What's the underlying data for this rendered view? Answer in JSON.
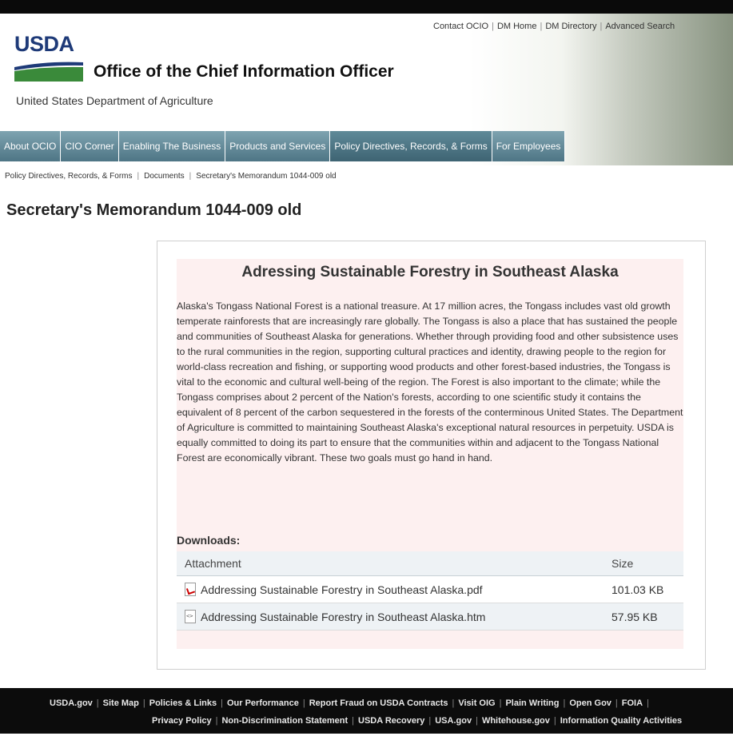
{
  "top_links": [
    "Contact OCIO",
    "DM Home",
    "DM Directory",
    "Advanced Search"
  ],
  "logo_text": "USDA",
  "site_title": "Office of the Chief Information Officer",
  "site_subtitle": "United States Department of Agriculture",
  "nav": [
    {
      "label": "About OCIO"
    },
    {
      "label": "CIO Corner"
    },
    {
      "label": "Enabling The Business"
    },
    {
      "label": "Products and Services"
    },
    {
      "label": "Policy Directives, Records, & Forms"
    },
    {
      "label": "For Employees"
    }
  ],
  "breadcrumb": [
    "Policy Directives, Records, & Forms",
    "Documents",
    "Secretary's Memorandum 1044-009 old"
  ],
  "page_title": "Secretary's Memorandum 1044-009 old",
  "article": {
    "title": "Adressing Sustainable Forestry in Southeast Alaska",
    "body": "Alaska's Tongass National Forest is a national treasure. At 17 million acres, the Tongass includes vast old growth temperate rainforests that are increasingly rare globally. The Tongass is also a place that has sustained the people and communities of Southeast Alaska for generations. Whether through providing food and other subsistence uses to the rural communities in the region, supporting cultural practices and identity, drawing people to the region for world-class recreation and fishing, or supporting wood products and other forest-based industries, the Tongass is vital to the economic and cultural well-being of the region. The Forest is also important to the climate; while the Tongass comprises about 2 percent of the Nation's forests, according to one scientific study it contains the equivalent of 8 percent of the carbon sequestered in the forests of the conterminous United States. The Department of Agriculture is committed to maintaining Southeast Alaska's exceptional natural resources in perpetuity. USDA is equally committed to doing its part to ensure that the communities within and adjacent to the Tongass National Forest are economically vibrant. These two goals must go hand in hand."
  },
  "downloads": {
    "label": "Downloads:",
    "columns": [
      "Attachment",
      "Size"
    ],
    "rows": [
      {
        "icon": "pdf-file-icon",
        "name": "Addressing Sustainable Forestry in Southeast Alaska.pdf",
        "size": "101.03 KB"
      },
      {
        "icon": "html-file-icon",
        "name": "Addressing Sustainable Forestry in Southeast Alaska.htm",
        "size": "57.95 KB"
      }
    ]
  },
  "footer": {
    "row1": [
      "USDA.gov",
      "Site Map",
      "Policies & Links",
      "Our Performance",
      "Report Fraud on USDA Contracts",
      "Visit OIG",
      "Plain Writing",
      "Open Gov",
      "FOIA"
    ],
    "row2": [
      "Privacy Policy",
      "Non-Discrimination Statement",
      "USDA Recovery",
      "USA.gov",
      "Whitehouse.gov",
      "Information Quality Activities"
    ]
  },
  "colors": {
    "logo_blue": "#1e3a78",
    "logo_green": "#3a8a3a",
    "nav_bg": "#5a7f8e",
    "content_bg": "#fdf0f0",
    "footer_bg": "#0c0c0c"
  }
}
